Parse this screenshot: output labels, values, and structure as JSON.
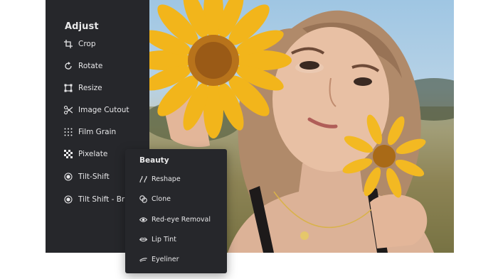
{
  "adjust_panel": {
    "title": "Adjust",
    "items": [
      {
        "label": "Crop",
        "icon": "crop-icon"
      },
      {
        "label": "Rotate",
        "icon": "rotate-icon"
      },
      {
        "label": "Resize",
        "icon": "resize-icon"
      },
      {
        "label": "Image Cutout",
        "icon": "scissors-icon"
      },
      {
        "label": "Film Grain",
        "icon": "film-grain-icon"
      },
      {
        "label": "Pixelate",
        "icon": "pixelate-icon"
      },
      {
        "label": "Tilt-Shift",
        "icon": "tilt-shift-icon"
      },
      {
        "label": "Tilt Shift - Brush",
        "icon": "tilt-shift-brush-icon"
      }
    ]
  },
  "beauty_panel": {
    "title": "Beauty",
    "items": [
      {
        "label": "Reshape",
        "icon": "reshape-icon"
      },
      {
        "label": "Clone",
        "icon": "clone-icon"
      },
      {
        "label": "Red-eye Removal",
        "icon": "eye-icon"
      },
      {
        "label": "Lip Tint",
        "icon": "lips-icon"
      },
      {
        "label": "Eyeliner",
        "icon": "eyeliner-icon"
      }
    ]
  },
  "colors": {
    "panel_bg": "#26272b",
    "panel_text": "#e9e9ea",
    "sunflower_petal": "#f2b51b",
    "sunflower_center": "#b8731b"
  }
}
